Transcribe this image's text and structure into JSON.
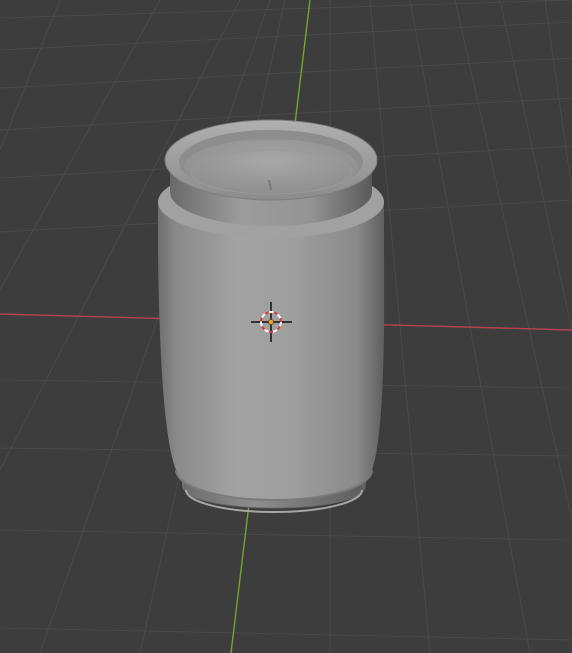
{
  "viewport": {
    "view_type": "3D Viewport",
    "shading_mode": "solid"
  },
  "scene": {
    "object_name": "can",
    "object_color": "#9a9a9a",
    "background_color": "#3d3d3d",
    "grid_color": "#4a4a4a",
    "x_axis_color": "#b4434f",
    "y_axis_color": "#73a62b"
  },
  "icons": {
    "cursor_icon": "3d-cursor-icon"
  }
}
